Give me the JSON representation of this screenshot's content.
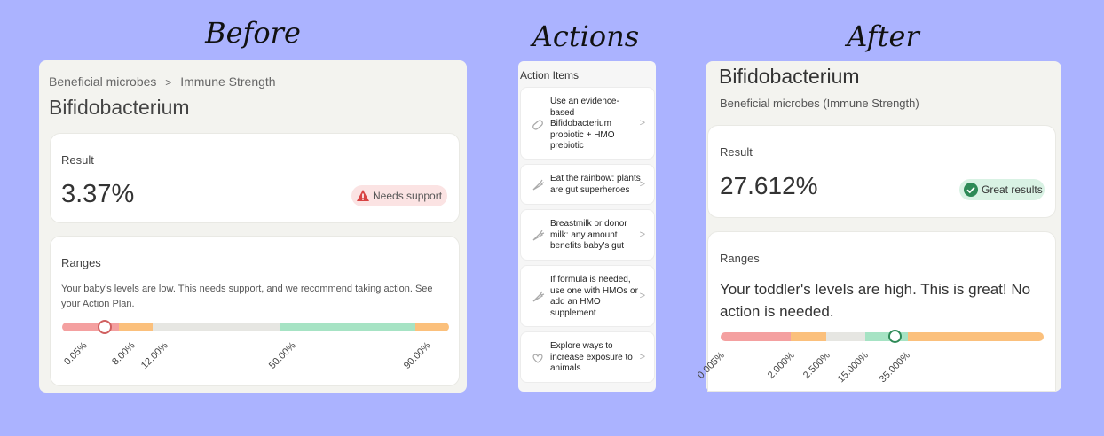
{
  "headings": {
    "before": "Before",
    "actions": "Actions",
    "after": "After"
  },
  "before": {
    "breadcrumb_parent": "Beneficial microbes",
    "breadcrumb_sep": ">",
    "breadcrumb_current": "Immune Strength",
    "title": "Bifidobacterium",
    "result_label": "Result",
    "result_value": "3.37%",
    "badge_text": "Needs support",
    "ranges_label": "Ranges",
    "ranges_desc_line1": "Your baby's levels are low. This needs support, and we recommend taking action. See",
    "ranges_desc_line2": "your Action Plan.",
    "ticks": [
      "0.05%",
      "8.00%",
      "12.00%",
      "50.00%",
      "90.00%"
    ],
    "colors": {
      "red": "#f4a0a0",
      "orange": "#fbc07c",
      "grey": "#e6e6e2",
      "green": "#a6e3c4",
      "badge_bg": "#fbe3e3",
      "badge_icon": "#d84343"
    }
  },
  "actions": {
    "title": "Action Items",
    "items": [
      {
        "text": "Use an evidence-\nbased\nBifidobacterium\nprobiotic + HMO\nprebiotic",
        "icon": "pill-icon"
      },
      {
        "text": "Eat the rainbow: plants\nare gut superheroes",
        "icon": "carrot-icon"
      },
      {
        "text": "Breastmilk or donor\nmilk: any amount\nbenefits baby's gut",
        "icon": "carrot-icon"
      },
      {
        "text": "If formula is needed,\nuse one with HMOs or\nadd an HMO\nsupplement",
        "icon": "carrot-icon"
      },
      {
        "text": "Explore ways to\nincrease exposure to\nanimals",
        "icon": "heart-icon"
      }
    ],
    "chevron": ">"
  },
  "after": {
    "title": "Bifidobacterium",
    "subtitle": "Beneficial microbes (Immune Strength)",
    "result_label": "Result",
    "result_value": "27.612%",
    "badge_text": "Great results",
    "ranges_label": "Ranges",
    "ranges_desc_line1": "Your toddler's levels are high. This is great! No",
    "ranges_desc_line2": "action is needed.",
    "ticks": [
      "0.005%",
      "2.000%",
      "2.500%",
      "15.000%",
      "35.000%"
    ],
    "colors": {
      "red": "#f4a0a0",
      "orange": "#fbc07c",
      "grey": "#e6e6e2",
      "green": "#a6e3c4",
      "badge_bg": "#d9f2e4",
      "badge_icon": "#2e8a57"
    }
  }
}
